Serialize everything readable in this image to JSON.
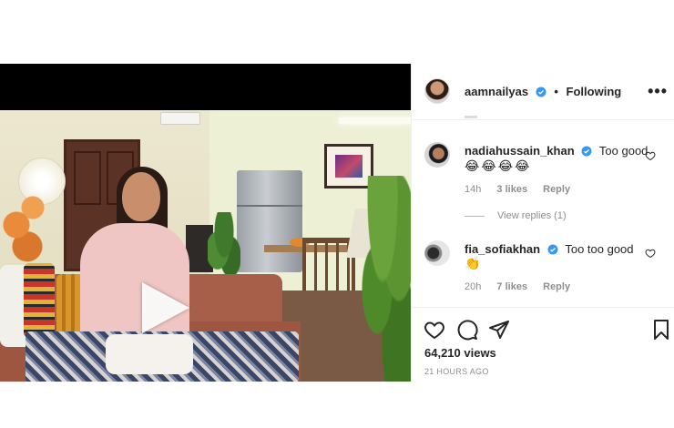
{
  "post": {
    "author": "aamnailyas",
    "separator": "•",
    "follow_status": "Following",
    "more_label": "•••"
  },
  "comments": [
    {
      "username": "nadiahussain_khan",
      "text": "Too good",
      "emoji": "😂😂😂😂",
      "age": "14h",
      "likes": "3 likes",
      "reply_label": "Reply"
    },
    {
      "username": "fia_sofiakhan",
      "text": "Too too good",
      "emoji": "👏",
      "age": "20h",
      "likes": "7 likes",
      "reply_label": "Reply"
    }
  ],
  "view_replies_label": "View replies (1)",
  "stats": {
    "views": "64,210 views",
    "posted": "21 HOURS AGO"
  },
  "icons": {
    "play": "play-icon",
    "mute": "volume-muted-icon",
    "like": "heart-icon",
    "comment": "comment-icon",
    "share": "share-icon",
    "save": "bookmark-icon",
    "verified": "verified-badge-icon",
    "more": "more-options-icon"
  },
  "colors": {
    "verified_blue": "#3897f0",
    "muted_text": "#8e8e8e",
    "primary_text": "#262626"
  }
}
